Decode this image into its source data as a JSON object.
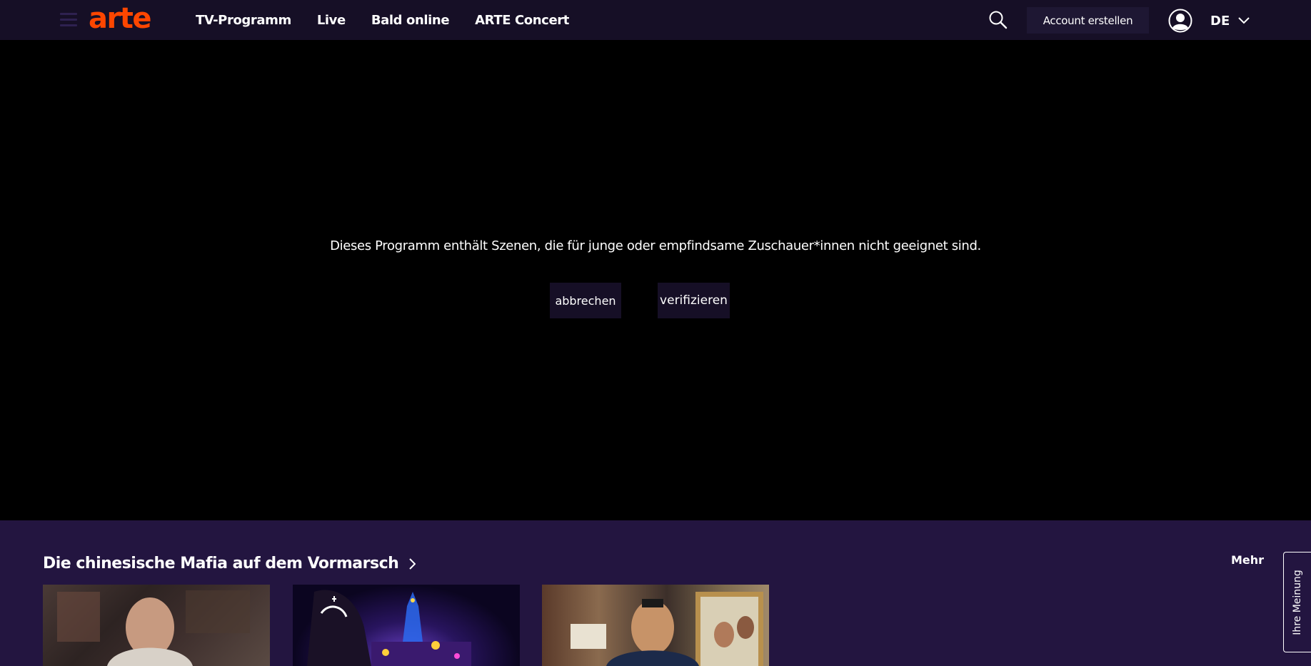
{
  "header": {
    "logo": "arte",
    "nav": [
      "TV-Programm",
      "Live",
      "Bald online",
      "ARTE Concert"
    ],
    "account_button": "Account erstellen",
    "language": "DE",
    "icons": [
      "menu-icon",
      "search-icon",
      "user-icon",
      "chevron-down-icon"
    ]
  },
  "player": {
    "warning": "Dieses Programm enthält Szenen, die für junge oder empfindsame Zuschauer*innen nicht geeignet sind.",
    "cancel_label": "abbrechen",
    "verify_label": "verifizieren"
  },
  "section": {
    "title": "Die chinesische Mafia auf dem Vormarsch",
    "more_label": "Mehr"
  },
  "feedback_label": "Ihre Meinung",
  "colors": {
    "header_bg": "#160f26",
    "player_bg": "#000000",
    "section_bg": "#231540",
    "brand": "#fd4600",
    "button_bg": "#160f26"
  }
}
